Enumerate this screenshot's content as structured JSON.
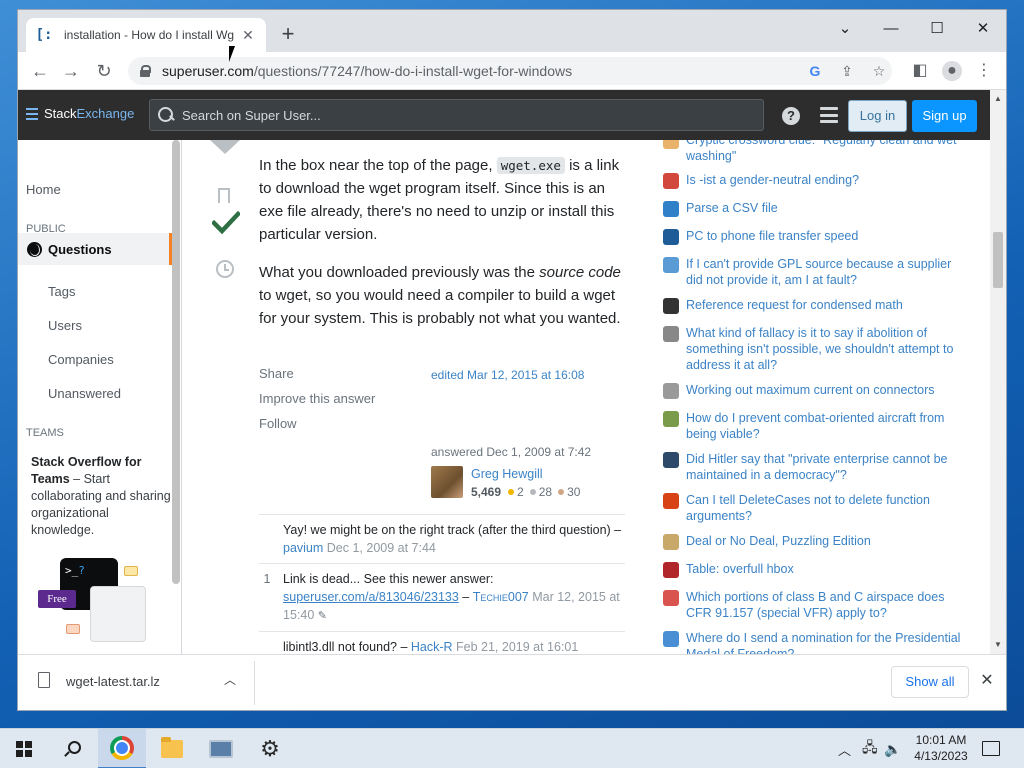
{
  "browser": {
    "tab_title": "installation - How do I install Wg",
    "tab_favicon": "[:",
    "url_host": "superuser.com",
    "url_path": "/questions/77247/how-do-i-install-wget-for-windows"
  },
  "se_bar": {
    "logo_stack": "Stack",
    "logo_exchange": "Exchange",
    "search_placeholder": "Search on Super User...",
    "help_label": "?",
    "login_label": "Log in",
    "signup_label": "Sign up"
  },
  "leftnav": {
    "home": "Home",
    "public_label": "PUBLIC",
    "questions": "Questions",
    "tags": "Tags",
    "users": "Users",
    "companies": "Companies",
    "unanswered": "Unanswered",
    "teams_label": "TEAMS",
    "teams_title": "Stack Overflow for Teams",
    "teams_body": " – Start collaborating and sharing organizational knowledge.",
    "illus_prompt": ">_",
    "illus_q": "?",
    "illus_free": "Free"
  },
  "answer": {
    "p1_a": "In the box near the top of the page, ",
    "p1_code": "wget.exe",
    "p1_b": " is a link to download the wget program itself. Since this is an exe file already, there's no need to unzip or install this particular version.",
    "p2_a": "What you downloaded previously was the ",
    "p2_em": "source code",
    "p2_b": " to wget, so you would need a compiler to build a wget for your system. This is probably not what you wanted.",
    "share": "Share",
    "improve": "Improve this answer",
    "follow": "Follow",
    "edited": "edited Mar 12, 2015 at 16:08",
    "answered": "answered Dec 1, 2009 at 7:42",
    "user_name": "Greg Hewgill",
    "user_rep": "5,469",
    "gold": "2",
    "silver": "28",
    "bronze": "30"
  },
  "comments": [
    {
      "score": "",
      "text": "Yay! we might be on the right track (after the third question) – ",
      "user": "pavium",
      "date": " Dec 1, 2009 at 7:44"
    },
    {
      "score": "1",
      "text": "Link is dead... See this newer answer: ",
      "link": "superuser.com/a/813046/23133",
      "sep": " – ",
      "user": "Techie007",
      "date": " Mar 12, 2015 at 15:40"
    },
    {
      "score": "",
      "text": "libintl3.dll not found? – ",
      "user": "Hack-R",
      "date": " Feb 21, 2019 at 16:01"
    }
  ],
  "hnq": [
    {
      "text": "Cryptic crossword clue: \"Regularly clean and wet washing\"",
      "icon": "puzzle",
      "color": "#e9b36b"
    },
    {
      "text": "Is -ist a gender-neutral ending?",
      "icon": "ell",
      "color": "#d2483d"
    },
    {
      "text": "Parse a CSV file",
      "icon": "codegolf",
      "color": "#2f80c8"
    },
    {
      "text": "PC to phone file transfer speed",
      "icon": "superuser",
      "color": "#1e5c97"
    },
    {
      "text": "If I can't provide GPL source because a supplier did not provide it, am I at fault?",
      "icon": "opensource",
      "color": "#5b9bd5"
    },
    {
      "text": "Reference request for condensed math",
      "icon": "mathoverflow",
      "color": "#333"
    },
    {
      "text": "What kind of fallacy is it to say if abolition of something isn't possible, we shouldn't attempt to address it at all?",
      "icon": "philosophy",
      "color": "#888"
    },
    {
      "text": "Working out maximum current on connectors",
      "icon": "electronics",
      "color": "#9a9a9a"
    },
    {
      "text": "How do I prevent combat-oriented aircraft from being viable?",
      "icon": "worldbuilding",
      "color": "#7a9b4a"
    },
    {
      "text": "Did Hitler say that \"private enterprise cannot be maintained in a democracy\"?",
      "icon": "skeptics",
      "color": "#2e4a6b"
    },
    {
      "text": "Can I tell DeleteCases not to delete function arguments?",
      "icon": "mathematica",
      "color": "#d84315"
    },
    {
      "text": "Deal or No Deal, Puzzling Edition",
      "icon": "puzzling",
      "color": "#c9a96a"
    },
    {
      "text": "Table: overfull hbox",
      "icon": "tex",
      "color": "#b0262b"
    },
    {
      "text": "Which portions of class B and C airspace does CFR 91.157 (special VFR) apply to?",
      "icon": "aviation",
      "color": "#d9534f"
    },
    {
      "text": "Where do I send a nomination for the Presidential Medal of Freedom?",
      "icon": "politics",
      "color": "#4a8fd3"
    }
  ],
  "downloads": {
    "file_name": "wget-latest.tar.lz",
    "show_all": "Show all"
  },
  "taskbar": {
    "time": "10:01 AM",
    "date": "4/13/2023"
  }
}
